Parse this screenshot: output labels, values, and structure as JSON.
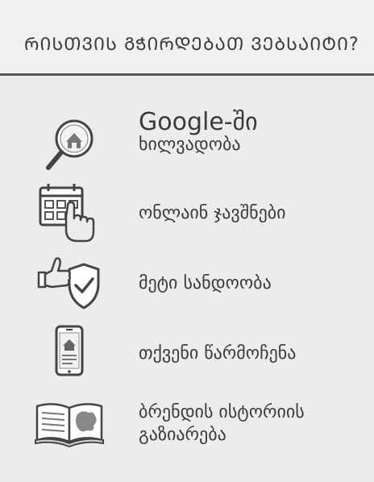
{
  "header": {
    "title": "ᲠᲘᲡᲗᲕᲘᲡ ᲒᲭᲘᲠᲓᲔᲑᲐᲗ ᲕᲔᲑᲡᲐᲘᲢᲘ?"
  },
  "items": [
    {
      "icon": "magnifier-house-icon",
      "line1": "Google-ში",
      "line2": "ხილვადობა"
    },
    {
      "icon": "calendar-touch-icon",
      "line1": "ონლაინ ჯავშნები"
    },
    {
      "icon": "thumbs-up-shield-icon",
      "line1": "მეტი სანდოობა"
    },
    {
      "icon": "phone-house-icon",
      "line1": "თქვენი წარმოჩენა"
    },
    {
      "icon": "open-book-icon",
      "line1": "ბრენდის ისტორიის",
      "line2": "გაზიარება"
    }
  ]
}
